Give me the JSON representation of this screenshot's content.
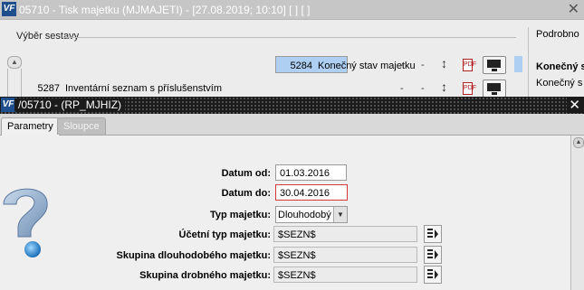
{
  "background_window": {
    "title": "05710 - Tisk majetku (MJMAJETI) - [27.08.2019; 10:10]  [ ]  [ ]",
    "logo_text": "VF",
    "group_label": "Výběr sestavy",
    "rows": [
      {
        "code": "5284",
        "name": "Konečný stav majetku",
        "dash1": "-",
        "dash2": "-",
        "pdf": "PDF"
      },
      {
        "code": "5287",
        "name": "Inventární seznam s příslušenstvím",
        "dash1": "-",
        "dash2": "-",
        "pdf": "PDF"
      }
    ],
    "right_panel": {
      "title": "Podrobno",
      "bold_label": "Konečný s",
      "text": "Konečný s"
    }
  },
  "dialog": {
    "title": "/05710 - (RP_MJHIZ)",
    "logo_text": "VF",
    "tabs": [
      {
        "label": "Parametry"
      },
      {
        "label": "Sloupce"
      }
    ],
    "fields": {
      "datum_od": {
        "label": "Datum od:",
        "value": "01.03.2016"
      },
      "datum_do": {
        "label": "Datum do:",
        "value": "30.04.2016"
      },
      "typ_majetku": {
        "label": "Typ majetku:",
        "value": "Dlouhodobý"
      },
      "ucetni_typ": {
        "label": "Účetní typ majetku:",
        "value": "$SEZN$"
      },
      "skupina_dlouh": {
        "label": "Skupina dlouhodobého majetku:",
        "value": "$SEZN$"
      },
      "skupina_drob": {
        "label": "Skupina drobného majetku:",
        "value": "$SEZN$"
      }
    }
  },
  "colors": {
    "selection": "#aecff2",
    "error_border": "#d43a3a",
    "dialog_titlebar": "#1b1b1b",
    "app_blue": "#1e4f8c"
  },
  "icons": [
    "sort-arrows-icon",
    "pdf-icon",
    "monitor-icon",
    "question-mark-icon",
    "list-picker-icon",
    "close-icon"
  ]
}
